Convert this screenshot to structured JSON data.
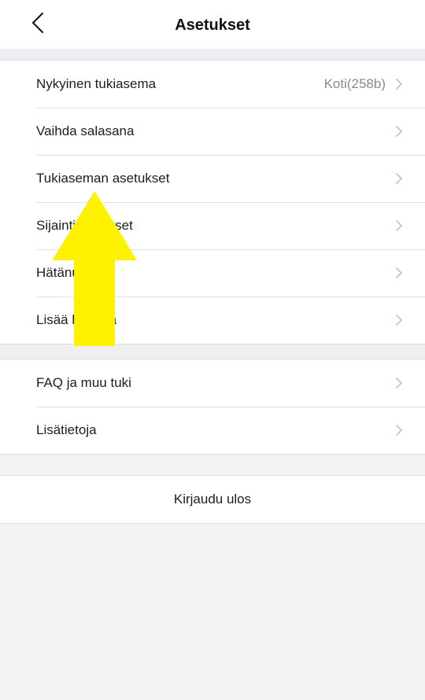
{
  "header": {
    "title": "Asetukset"
  },
  "groups": [
    {
      "items": [
        {
          "label": "Nykyinen tukiasema",
          "value": "Koti(258b)"
        },
        {
          "label": "Vaihda salasana"
        },
        {
          "label": "Tukiaseman asetukset"
        },
        {
          "label": "Sijaintiasetukset"
        },
        {
          "label": "Hätänumero"
        },
        {
          "label": "Lisää kamera"
        }
      ]
    },
    {
      "items": [
        {
          "label": "FAQ ja muu tuki"
        },
        {
          "label": "Lisätietoja"
        }
      ]
    }
  ],
  "logout_label": "Kirjaudu ulos",
  "colors": {
    "arrow": "#fff200",
    "background": "#f3f3f5",
    "chevron": "#c4c4c7"
  },
  "icons": {
    "back": "chevron-left-icon",
    "row": "chevron-right-icon",
    "annotation": "arrow-up-icon"
  }
}
